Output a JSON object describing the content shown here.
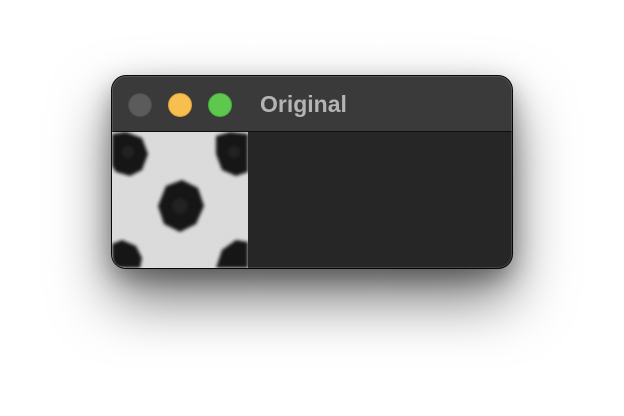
{
  "window": {
    "title": "Original",
    "controls": [
      {
        "name": "close-button",
        "color": "#5b5b5b"
      },
      {
        "name": "minimize-button",
        "color": "#f6bf4f"
      },
      {
        "name": "zoom-button",
        "color": "#5ec84e"
      }
    ]
  },
  "content": {
    "image_description_icon": "image-thumbnail",
    "background_color": "#262626",
    "image_background_color": "#dcdcdc"
  }
}
